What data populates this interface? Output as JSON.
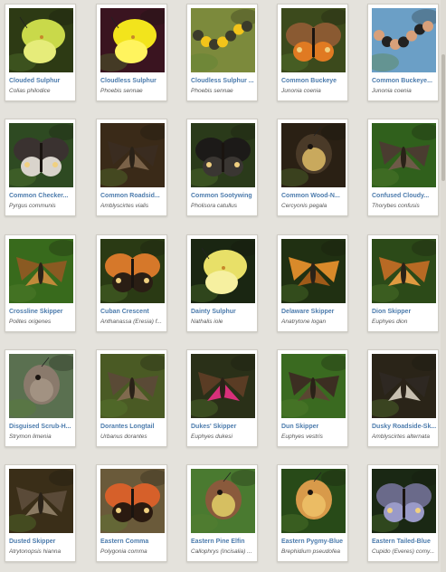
{
  "grid": {
    "items": [
      {
        "name": "Clouded Sulphur",
        "sci": "Colias philodice",
        "bg": "#2d3a14",
        "wing": "#c9d94a",
        "wing2": "#e6ec7a",
        "shape": "sulphur",
        "icon": "butterfly-icon"
      },
      {
        "name": "Cloudless Sulphur",
        "sci": "Phoebis sennae",
        "bg": "#3a1420",
        "wing": "#f2e41c",
        "wing2": "#fff45e",
        "shape": "sulphur",
        "icon": "butterfly-icon"
      },
      {
        "name": "Cloudless Sulphur ...",
        "sci": "Phoebis sennae",
        "bg": "#7c8a3c",
        "wing": "#f2c41a",
        "wing2": "#3b3b2a",
        "shape": "caterpillar",
        "icon": "caterpillar-icon"
      },
      {
        "name": "Common Buckeye",
        "sci": "Junonia coenia",
        "bg": "#3c4a1c",
        "wing": "#8a5a32",
        "wing2": "#e07a22",
        "shape": "open",
        "icon": "butterfly-icon"
      },
      {
        "name": "Common Buckeye...",
        "sci": "Junonia coenia",
        "bg": "#6b9fc6",
        "wing": "#222222",
        "wing2": "#d8a07a",
        "shape": "caterpillar",
        "icon": "caterpillar-icon"
      },
      {
        "name": "Common Checker...",
        "sci": "Pyrgus communis",
        "bg": "#2e4a22",
        "wing": "#3a3230",
        "wing2": "#d9d4cc",
        "shape": "open",
        "icon": "butterfly-icon"
      },
      {
        "name": "Common Roadsid...",
        "sci": "Amblyscirtes vialis",
        "bg": "#3a2a18",
        "wing": "#3a2c20",
        "wing2": "#7a6248",
        "shape": "skipper",
        "icon": "butterfly-icon"
      },
      {
        "name": "Common Sootywing",
        "sci": "Pholisora catullus",
        "bg": "#2a3a1a",
        "wing": "#1c1a18",
        "wing2": "#3a3632",
        "shape": "open",
        "icon": "butterfly-icon"
      },
      {
        "name": "Common Wood-N...",
        "sci": "Cercyonis pegala",
        "bg": "#2a2014",
        "wing": "#4a3a28",
        "wing2": "#e8c66a",
        "shape": "closed",
        "icon": "butterfly-icon"
      },
      {
        "name": "Confused Cloudy...",
        "sci": "Thorybes confusis",
        "bg": "#30601c",
        "wing": "#4a3c30",
        "wing2": "#6e5a48",
        "shape": "skipper",
        "icon": "butterfly-icon"
      },
      {
        "name": "Crossline Skipper",
        "sci": "Polites origenes",
        "bg": "#386a1c",
        "wing": "#8a5a22",
        "wing2": "#c08a3a",
        "shape": "skipper",
        "icon": "butterfly-icon"
      },
      {
        "name": "Cuban Crescent",
        "sci": "Anthanassa (Eresia) f...",
        "bg": "#2a3a14",
        "wing": "#d6782a",
        "wing2": "#2a1e14",
        "shape": "open",
        "icon": "butterfly-icon"
      },
      {
        "name": "Dainty Sulphur",
        "sci": "Nathalis iole",
        "bg": "#1a2612",
        "wing": "#e8e068",
        "wing2": "#f6f0a0",
        "shape": "sulphur",
        "icon": "butterfly-icon"
      },
      {
        "name": "Delaware Skipper",
        "sci": "Anatrytone logan",
        "bg": "#203012",
        "wing": "#d98a2a",
        "wing2": "#a05a18",
        "shape": "skipper",
        "icon": "butterfly-icon"
      },
      {
        "name": "Dion Skipper",
        "sci": "Euphyes dion",
        "bg": "#2c4a18",
        "wing": "#b86a24",
        "wing2": "#e09a40",
        "shape": "skipper",
        "icon": "butterfly-icon"
      },
      {
        "name": "Disguised Scrub-H...",
        "sci": "Strymon limenia",
        "bg": "#5a7050",
        "wing": "#8a7a6c",
        "wing2": "#a89888",
        "shape": "closed",
        "icon": "butterfly-icon"
      },
      {
        "name": "Dorantes Longtail",
        "sci": "Urbanus dorantes",
        "bg": "#4a5a24",
        "wing": "#5a4a36",
        "wing2": "#806a4e",
        "shape": "skipper",
        "icon": "butterfly-icon"
      },
      {
        "name": "Dukes' Skipper",
        "sci": "Euphyes dukesi",
        "bg": "#2a3018",
        "wing": "#5a3c24",
        "wing2": "#d8307a",
        "shape": "skipper",
        "icon": "butterfly-icon"
      },
      {
        "name": "Dun Skipper",
        "sci": "Euphyes vestris",
        "bg": "#3a6a20",
        "wing": "#3c2e22",
        "wing2": "#5a4632",
        "shape": "skipper",
        "icon": "butterfly-icon"
      },
      {
        "name": "Dusky Roadside-Sk...",
        "sci": "Amblyscirtes alternata",
        "bg": "#2a2418",
        "wing": "#2e2822",
        "wing2": "#c8c0b0",
        "shape": "skipper",
        "icon": "butterfly-icon"
      },
      {
        "name": "Dusted Skipper",
        "sci": "Atrytonopsis hianna",
        "bg": "#3a2e18",
        "wing": "#5a4a38",
        "wing2": "#8a7a62",
        "shape": "skipper",
        "icon": "butterfly-icon"
      },
      {
        "name": "Eastern Comma",
        "sci": "Polygonia comma",
        "bg": "#6a5a3a",
        "wing": "#d6602a",
        "wing2": "#2a1a10",
        "shape": "open",
        "icon": "butterfly-icon"
      },
      {
        "name": "Eastern Pine Elfin",
        "sci": "Callophrys (Incisalia) ...",
        "bg": "#4a7a30",
        "wing": "#8a5a3c",
        "wing2": "#e8d86a",
        "shape": "closed",
        "icon": "butterfly-icon"
      },
      {
        "name": "Eastern Pygmy-Blue",
        "sci": "Brephidium pseudofea",
        "bg": "#284a18",
        "wing": "#d89a4a",
        "wing2": "#f0c46a",
        "shape": "closed",
        "icon": "butterfly-icon"
      },
      {
        "name": "Eastern Tailed-Blue",
        "sci": "Cupido (Everes) comy...",
        "bg": "#1a2814",
        "wing": "#6a6a8a",
        "wing2": "#9a9ac8",
        "shape": "open",
        "icon": "butterfly-icon"
      }
    ]
  }
}
